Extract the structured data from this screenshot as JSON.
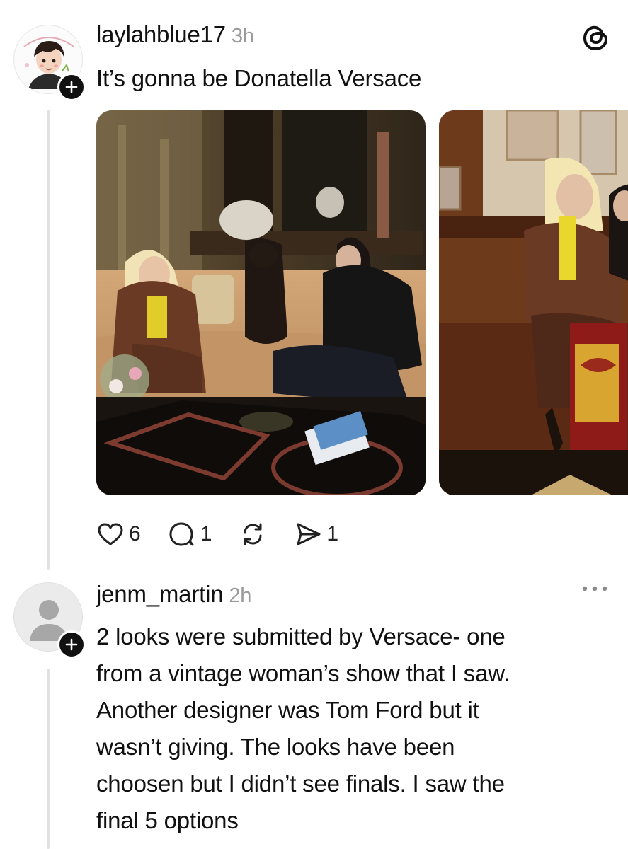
{
  "posts": [
    {
      "username": "laylahblue17",
      "time": "3h",
      "text": "It’s gonna be Donatella Versace",
      "avatar_icon": "cartoon-avatar-icon",
      "stats": {
        "likes": "6",
        "replies": "1",
        "reposts": "",
        "shares": "1"
      }
    },
    {
      "username": "jenm_martin",
      "time": "2h",
      "avatar_icon": "default-user-avatar-icon",
      "lines": [
        "2 looks were submitted by Versace- one",
        "from a vintage woman’s show that I saw.",
        "Another designer was Tom Ford but it",
        "wasn’t giving. The looks have been",
        "choosen but I didn’t see finals. I saw the",
        "final 5 options"
      ]
    }
  ],
  "icons": {
    "app": "threads-logo-icon",
    "more": "more-options-icon",
    "like": "heart-icon",
    "reply": "comment-icon",
    "repost": "repost-icon",
    "share": "send-icon",
    "follow": "plus-icon"
  },
  "colors": {
    "text": "#111111",
    "muted": "#9a9a9a",
    "thread_line": "#e2e2e2"
  }
}
